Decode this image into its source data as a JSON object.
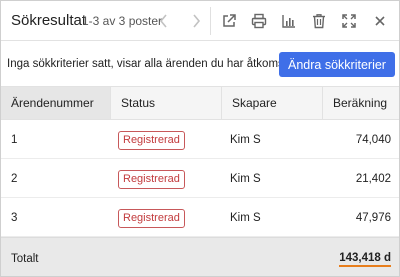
{
  "header": {
    "title": "Sökresultat",
    "count": "1-3 av 3 poster"
  },
  "infobar": {
    "text": "Inga sökkriterier satt, visar alla ärenden du har åtkomst till",
    "button_label": "Ändra sökkriterier",
    "button_color": "#3f6fe8"
  },
  "table": {
    "headers": {
      "number": "Ärendenummer",
      "status": "Status",
      "creator": "Skapare",
      "calculation": "Beräkning"
    },
    "rows": [
      {
        "number": "1",
        "status": "Registrerad",
        "creator": "Kim S",
        "calculation": "74,040"
      },
      {
        "number": "2",
        "status": "Registrerad",
        "creator": "Kim S",
        "calculation": "21,402"
      },
      {
        "number": "3",
        "status": "Registrerad",
        "creator": "Kim S",
        "calculation": "47,976"
      }
    ],
    "footer": {
      "label": "Totalt",
      "value": "143,418 d"
    }
  },
  "colors": {
    "status_badge": "#c23b3d",
    "total_underline": "#e87e1c"
  }
}
